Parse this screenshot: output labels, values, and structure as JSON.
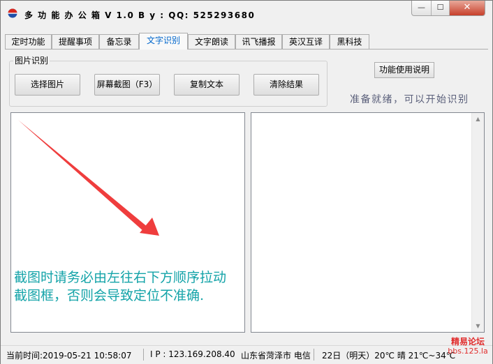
{
  "window": {
    "title": "多 功 能 办 公 箱 V 1.0    B y : QQ:  525293680",
    "min_glyph": "—",
    "max_glyph": "☐",
    "close_glyph": "✕"
  },
  "tabs": [
    {
      "label": "定时功能",
      "active": false
    },
    {
      "label": "提醒事项",
      "active": false
    },
    {
      "label": "备忘录",
      "active": false
    },
    {
      "label": "文字识别",
      "active": true
    },
    {
      "label": "文字朗读",
      "active": false
    },
    {
      "label": "讯飞播报",
      "active": false
    },
    {
      "label": "英汉互译",
      "active": false
    },
    {
      "label": "黑科技",
      "active": false
    }
  ],
  "ocr": {
    "group_label": "图片识别",
    "buttons": {
      "select_image": "选择图片",
      "screenshot": "屏幕截图（F3）",
      "copy_text": "复制文本",
      "clear_result": "清除结果"
    },
    "help_button": "功能使用说明",
    "status_message": "准备就绪，可以开始识别",
    "hint_line1": "截图时请务必由左往右下方顺序拉动",
    "hint_line2": "截图框，否则会导致定位不准确.",
    "result_text": ""
  },
  "statusbar": {
    "time": "当前时间:2019-05-21 10:58:07",
    "ip": "I P :   123.169.208.40",
    "location": "山东省菏泽市 电信",
    "weather": "22日（明天）20℃ 晴 21℃~34℃"
  },
  "watermark": {
    "name": "精易论坛",
    "domain": "bbs.125.la"
  },
  "colors": {
    "accent_tab": "#0066cc",
    "hint_text": "#13a3a8",
    "arrow": "#ef3d3d",
    "status_message": "#5a5f7a",
    "watermark": "#e12d2d"
  }
}
